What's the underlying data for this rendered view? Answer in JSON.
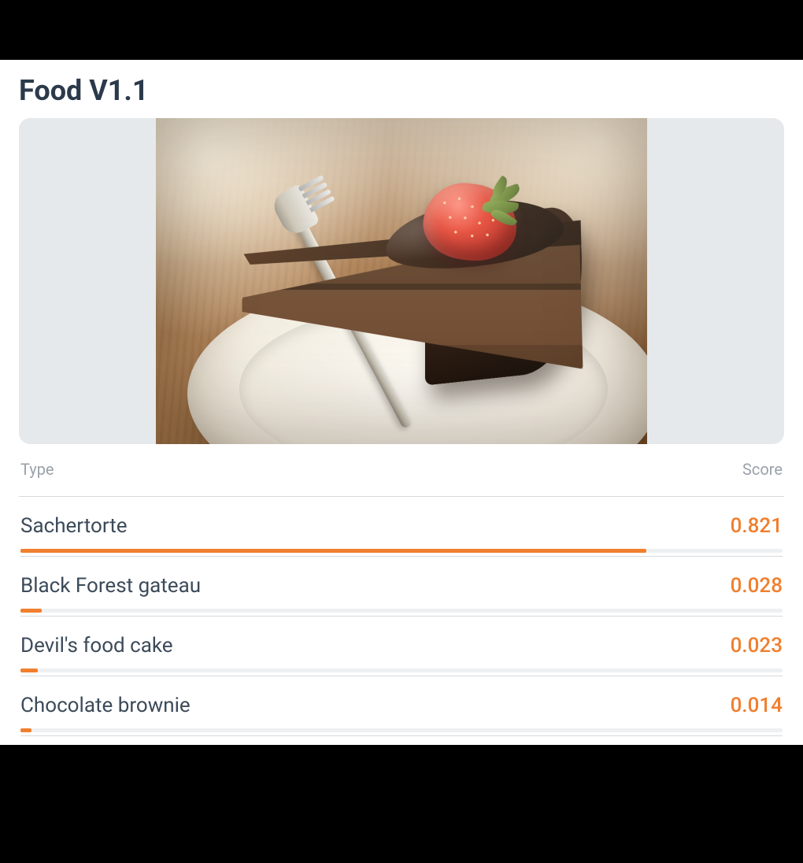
{
  "title": "Food V1.1",
  "columns": {
    "type": "Type",
    "score": "Score"
  },
  "image": {
    "subject": "chocolate-cake-slice-with-strawberry",
    "alt": "Slice of chocolate cake with glossy ganache and a strawberry on a white plate with a fork"
  },
  "colors": {
    "accent": "#f07f2e",
    "text": "#3c4a59",
    "muted": "#9aa1a9"
  },
  "results": [
    {
      "label": "Sachertorte",
      "score": 0.821,
      "score_text": "0.821"
    },
    {
      "label": "Black Forest gateau",
      "score": 0.028,
      "score_text": "0.028"
    },
    {
      "label": "Devil's food cake",
      "score": 0.023,
      "score_text": "0.023"
    },
    {
      "label": "Chocolate brownie",
      "score": 0.014,
      "score_text": "0.014"
    }
  ]
}
